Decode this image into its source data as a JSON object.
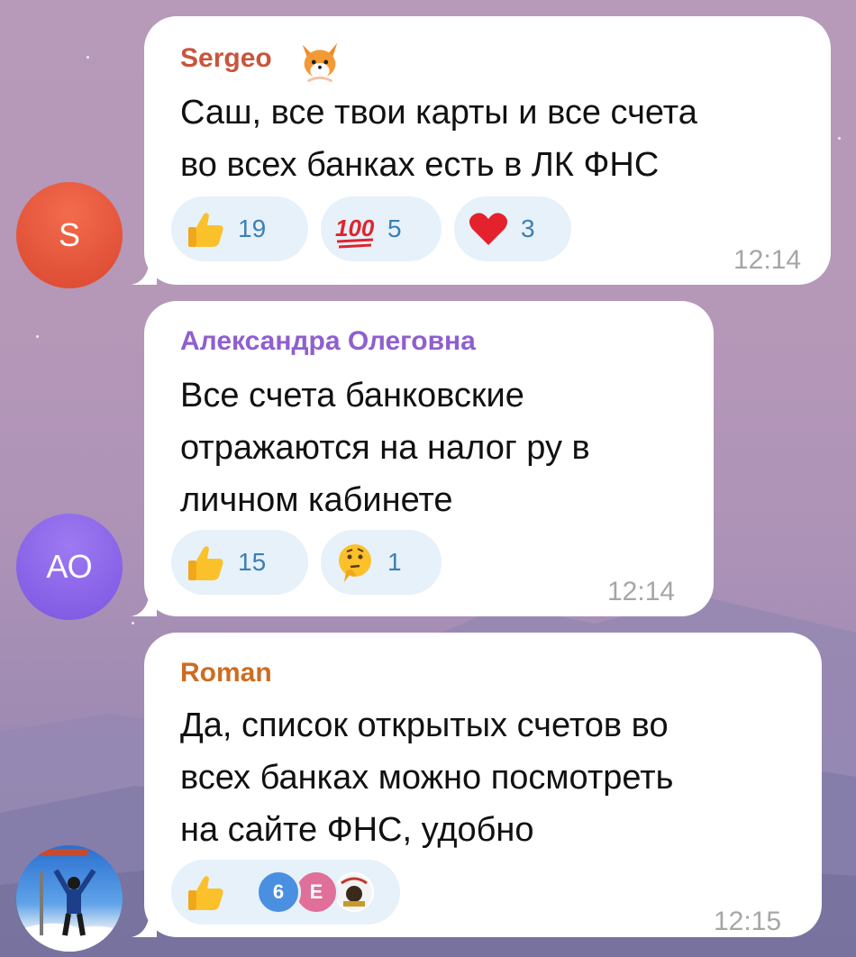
{
  "messages": [
    {
      "sender": "Sergeo",
      "sender_color": "#c8553d",
      "avatar_text": "S",
      "lines": [
        "Саш, все твои карты и все счета",
        "во всех банках есть в ЛК ФНС"
      ],
      "reactions": [
        {
          "icon": "thumbs-up-icon",
          "count": "19"
        },
        {
          "icon": "hundred-points-icon",
          "count": "5"
        },
        {
          "icon": "red-heart-icon",
          "count": "3"
        }
      ],
      "time": "12:14"
    },
    {
      "sender": "Александра Олеговна",
      "sender_color": "#8f5fcf",
      "avatar_text": "АО",
      "lines": [
        "Все счета банковские",
        "отражаются на налог ру в",
        "личном кабинете"
      ],
      "reactions": [
        {
          "icon": "thumbs-up-icon",
          "count": "15"
        },
        {
          "icon": "thinking-face-icon",
          "count": "1"
        }
      ],
      "time": "12:14"
    },
    {
      "sender": "Roman",
      "sender_color": "#cc6d22",
      "avatar_text": "",
      "lines": [
        "Да, список открытых счетов во",
        "всех банках можно посмотреть",
        "на сайте ФНС, удобно"
      ],
      "reactions": [
        {
          "icon": "thumbs-up-icon",
          "count": "",
          "reactor_avatars": [
            "6",
            "E",
            "logo"
          ]
        }
      ],
      "time": "12:15"
    }
  ],
  "colors": {
    "reaction_bg": "#e6f1fa",
    "reaction_count": "#3c7fb5",
    "avatar_s": "#e0533c",
    "avatar_ao": "#8a63e8",
    "mini_av_6": "#4a8fe0",
    "mini_av_e": "#e06f9a"
  }
}
